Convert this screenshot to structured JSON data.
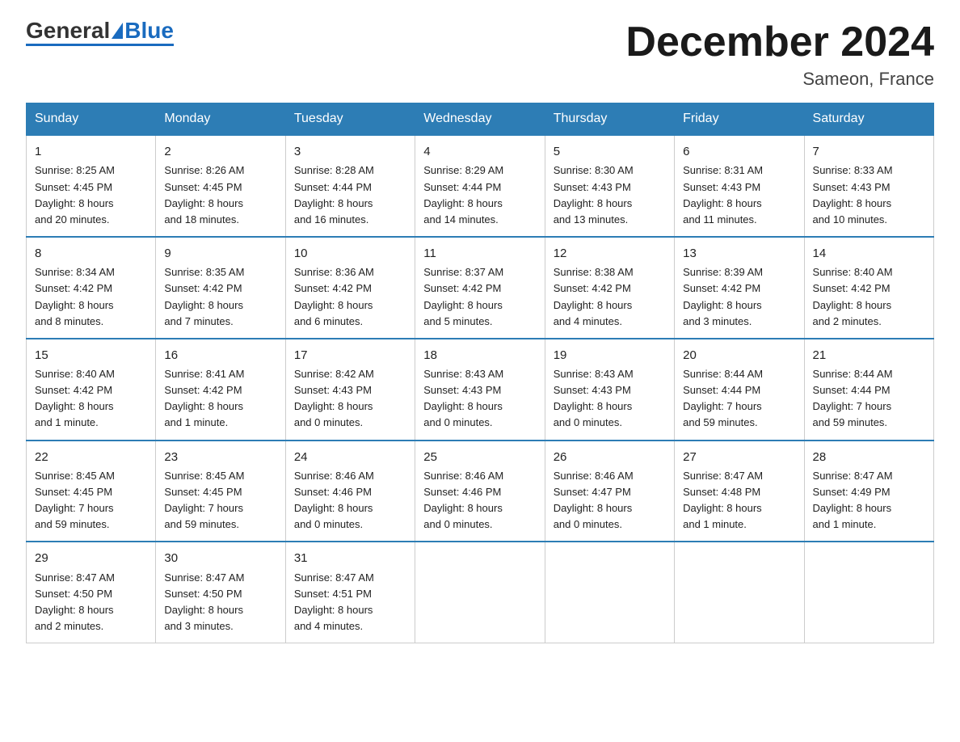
{
  "header": {
    "logo_general": "General",
    "logo_blue": "Blue",
    "month_title": "December 2024",
    "location": "Sameon, France"
  },
  "days_of_week": [
    "Sunday",
    "Monday",
    "Tuesday",
    "Wednesday",
    "Thursday",
    "Friday",
    "Saturday"
  ],
  "weeks": [
    [
      {
        "day": "1",
        "info": "Sunrise: 8:25 AM\nSunset: 4:45 PM\nDaylight: 8 hours\nand 20 minutes."
      },
      {
        "day": "2",
        "info": "Sunrise: 8:26 AM\nSunset: 4:45 PM\nDaylight: 8 hours\nand 18 minutes."
      },
      {
        "day": "3",
        "info": "Sunrise: 8:28 AM\nSunset: 4:44 PM\nDaylight: 8 hours\nand 16 minutes."
      },
      {
        "day": "4",
        "info": "Sunrise: 8:29 AM\nSunset: 4:44 PM\nDaylight: 8 hours\nand 14 minutes."
      },
      {
        "day": "5",
        "info": "Sunrise: 8:30 AM\nSunset: 4:43 PM\nDaylight: 8 hours\nand 13 minutes."
      },
      {
        "day": "6",
        "info": "Sunrise: 8:31 AM\nSunset: 4:43 PM\nDaylight: 8 hours\nand 11 minutes."
      },
      {
        "day": "7",
        "info": "Sunrise: 8:33 AM\nSunset: 4:43 PM\nDaylight: 8 hours\nand 10 minutes."
      }
    ],
    [
      {
        "day": "8",
        "info": "Sunrise: 8:34 AM\nSunset: 4:42 PM\nDaylight: 8 hours\nand 8 minutes."
      },
      {
        "day": "9",
        "info": "Sunrise: 8:35 AM\nSunset: 4:42 PM\nDaylight: 8 hours\nand 7 minutes."
      },
      {
        "day": "10",
        "info": "Sunrise: 8:36 AM\nSunset: 4:42 PM\nDaylight: 8 hours\nand 6 minutes."
      },
      {
        "day": "11",
        "info": "Sunrise: 8:37 AM\nSunset: 4:42 PM\nDaylight: 8 hours\nand 5 minutes."
      },
      {
        "day": "12",
        "info": "Sunrise: 8:38 AM\nSunset: 4:42 PM\nDaylight: 8 hours\nand 4 minutes."
      },
      {
        "day": "13",
        "info": "Sunrise: 8:39 AM\nSunset: 4:42 PM\nDaylight: 8 hours\nand 3 minutes."
      },
      {
        "day": "14",
        "info": "Sunrise: 8:40 AM\nSunset: 4:42 PM\nDaylight: 8 hours\nand 2 minutes."
      }
    ],
    [
      {
        "day": "15",
        "info": "Sunrise: 8:40 AM\nSunset: 4:42 PM\nDaylight: 8 hours\nand 1 minute."
      },
      {
        "day": "16",
        "info": "Sunrise: 8:41 AM\nSunset: 4:42 PM\nDaylight: 8 hours\nand 1 minute."
      },
      {
        "day": "17",
        "info": "Sunrise: 8:42 AM\nSunset: 4:43 PM\nDaylight: 8 hours\nand 0 minutes."
      },
      {
        "day": "18",
        "info": "Sunrise: 8:43 AM\nSunset: 4:43 PM\nDaylight: 8 hours\nand 0 minutes."
      },
      {
        "day": "19",
        "info": "Sunrise: 8:43 AM\nSunset: 4:43 PM\nDaylight: 8 hours\nand 0 minutes."
      },
      {
        "day": "20",
        "info": "Sunrise: 8:44 AM\nSunset: 4:44 PM\nDaylight: 7 hours\nand 59 minutes."
      },
      {
        "day": "21",
        "info": "Sunrise: 8:44 AM\nSunset: 4:44 PM\nDaylight: 7 hours\nand 59 minutes."
      }
    ],
    [
      {
        "day": "22",
        "info": "Sunrise: 8:45 AM\nSunset: 4:45 PM\nDaylight: 7 hours\nand 59 minutes."
      },
      {
        "day": "23",
        "info": "Sunrise: 8:45 AM\nSunset: 4:45 PM\nDaylight: 7 hours\nand 59 minutes."
      },
      {
        "day": "24",
        "info": "Sunrise: 8:46 AM\nSunset: 4:46 PM\nDaylight: 8 hours\nand 0 minutes."
      },
      {
        "day": "25",
        "info": "Sunrise: 8:46 AM\nSunset: 4:46 PM\nDaylight: 8 hours\nand 0 minutes."
      },
      {
        "day": "26",
        "info": "Sunrise: 8:46 AM\nSunset: 4:47 PM\nDaylight: 8 hours\nand 0 minutes."
      },
      {
        "day": "27",
        "info": "Sunrise: 8:47 AM\nSunset: 4:48 PM\nDaylight: 8 hours\nand 1 minute."
      },
      {
        "day": "28",
        "info": "Sunrise: 8:47 AM\nSunset: 4:49 PM\nDaylight: 8 hours\nand 1 minute."
      }
    ],
    [
      {
        "day": "29",
        "info": "Sunrise: 8:47 AM\nSunset: 4:50 PM\nDaylight: 8 hours\nand 2 minutes."
      },
      {
        "day": "30",
        "info": "Sunrise: 8:47 AM\nSunset: 4:50 PM\nDaylight: 8 hours\nand 3 minutes."
      },
      {
        "day": "31",
        "info": "Sunrise: 8:47 AM\nSunset: 4:51 PM\nDaylight: 8 hours\nand 4 minutes."
      },
      {
        "day": "",
        "info": ""
      },
      {
        "day": "",
        "info": ""
      },
      {
        "day": "",
        "info": ""
      },
      {
        "day": "",
        "info": ""
      }
    ]
  ]
}
